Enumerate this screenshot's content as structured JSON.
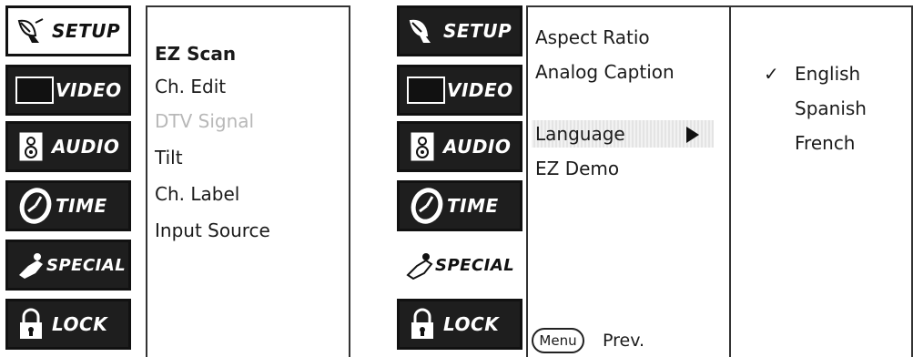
{
  "tabs": [
    {
      "label": "SETUP",
      "icon": "satellite-dish-icon"
    },
    {
      "label": "VIDEO",
      "icon": "screen-icon"
    },
    {
      "label": "AUDIO",
      "icon": "speaker-icon"
    },
    {
      "label": "TIME",
      "icon": "clock-icon"
    },
    {
      "label": "SPECIAL",
      "icon": "hand-pointer-icon"
    },
    {
      "label": "LOCK",
      "icon": "padlock-icon"
    }
  ],
  "left_menu": {
    "items": [
      {
        "label": "EZ Scan",
        "state": "selected"
      },
      {
        "label": "Ch. Edit",
        "state": "normal"
      },
      {
        "label": "DTV Signal",
        "state": "disabled"
      },
      {
        "label": "Tilt",
        "state": "normal"
      },
      {
        "label": "Ch. Label",
        "state": "normal"
      },
      {
        "label": "Input Source",
        "state": "normal"
      }
    ]
  },
  "right_menu": {
    "items": [
      {
        "label": "Aspect Ratio"
      },
      {
        "label": "Analog Caption"
      },
      {
        "label": "Language",
        "highlighted": true
      },
      {
        "label": "EZ Demo"
      }
    ],
    "menu_button": "Menu",
    "prev_label": "Prev."
  },
  "language_submenu": {
    "checkmark": "✓",
    "options": [
      {
        "label": "English",
        "checked": true
      },
      {
        "label": "Spanish",
        "checked": false
      },
      {
        "label": "French",
        "checked": false
      }
    ]
  }
}
